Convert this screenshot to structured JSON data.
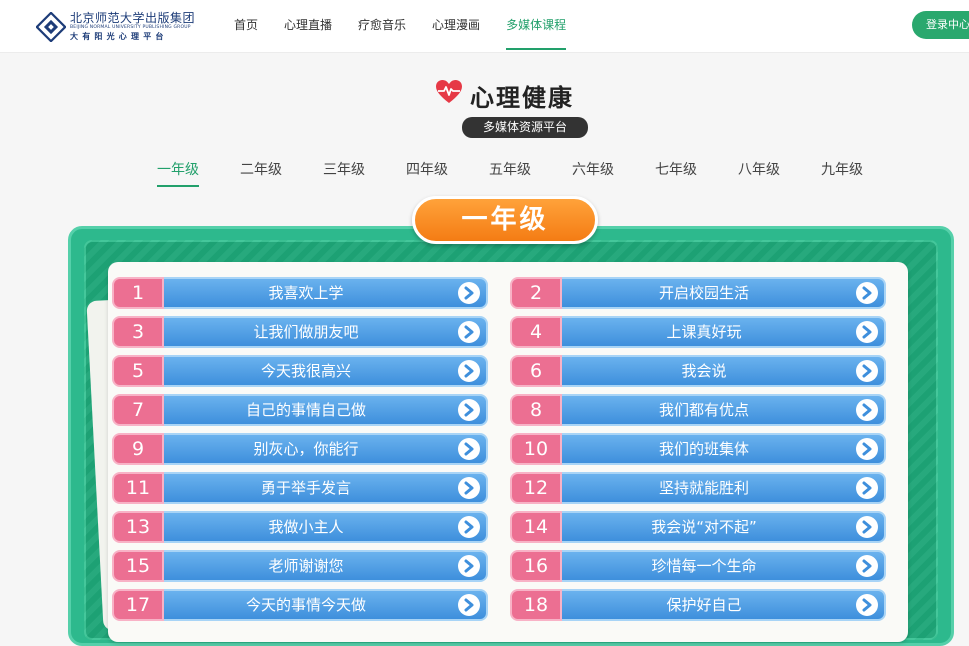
{
  "header": {
    "logo_title": "北京师范大学出版集团",
    "logo_en": "BEIJING NORMAL UNIVERSITY PUBLISHING GROUP",
    "logo_sub": "大有阳光心理平台",
    "login_label": "登录中心"
  },
  "nav": [
    {
      "label": "首页",
      "active": false
    },
    {
      "label": "心理直播",
      "active": false
    },
    {
      "label": "疗愈音乐",
      "active": false
    },
    {
      "label": "心理漫画",
      "active": false
    },
    {
      "label": "多媒体课程",
      "active": true
    }
  ],
  "brand": {
    "title": "心理健康",
    "badge": "多媒体资源平台"
  },
  "grades": [
    {
      "label": "一年级",
      "active": true
    },
    {
      "label": "二年级",
      "active": false
    },
    {
      "label": "三年级",
      "active": false
    },
    {
      "label": "四年级",
      "active": false
    },
    {
      "label": "五年级",
      "active": false
    },
    {
      "label": "六年级",
      "active": false
    },
    {
      "label": "七年级",
      "active": false
    },
    {
      "label": "八年级",
      "active": false
    },
    {
      "label": "九年级",
      "active": false
    }
  ],
  "current_grade": "一年级",
  "lessons": [
    {
      "num": "1",
      "title": "我喜欢上学"
    },
    {
      "num": "2",
      "title": "开启校园生活"
    },
    {
      "num": "3",
      "title": "让我们做朋友吧"
    },
    {
      "num": "4",
      "title": "上课真好玩"
    },
    {
      "num": "5",
      "title": "今天我很高兴"
    },
    {
      "num": "6",
      "title": "我会说"
    },
    {
      "num": "7",
      "title": "自己的事情自己做"
    },
    {
      "num": "8",
      "title": "我们都有优点"
    },
    {
      "num": "9",
      "title": "别灰心，你能行"
    },
    {
      "num": "10",
      "title": "我们的班集体"
    },
    {
      "num": "11",
      "title": "勇于举手发言"
    },
    {
      "num": "12",
      "title": "坚持就能胜利"
    },
    {
      "num": "13",
      "title": "我做小主人"
    },
    {
      "num": "14",
      "title": "我会说“对不起”"
    },
    {
      "num": "15",
      "title": "老师谢谢您"
    },
    {
      "num": "16",
      "title": "珍惜每一个生命"
    },
    {
      "num": "17",
      "title": "今天的事情今天做"
    },
    {
      "num": "18",
      "title": "保护好自己"
    }
  ],
  "colors": {
    "accent_green": "#22a06b",
    "board_green": "#2db98d",
    "number_pink": "#ec6f92",
    "lesson_blue": "#4a9ae2",
    "grade_orange": "#f7891f"
  },
  "icons": [
    "logo-mark-icon",
    "heart-pulse-icon",
    "chevron-right-icon"
  ]
}
